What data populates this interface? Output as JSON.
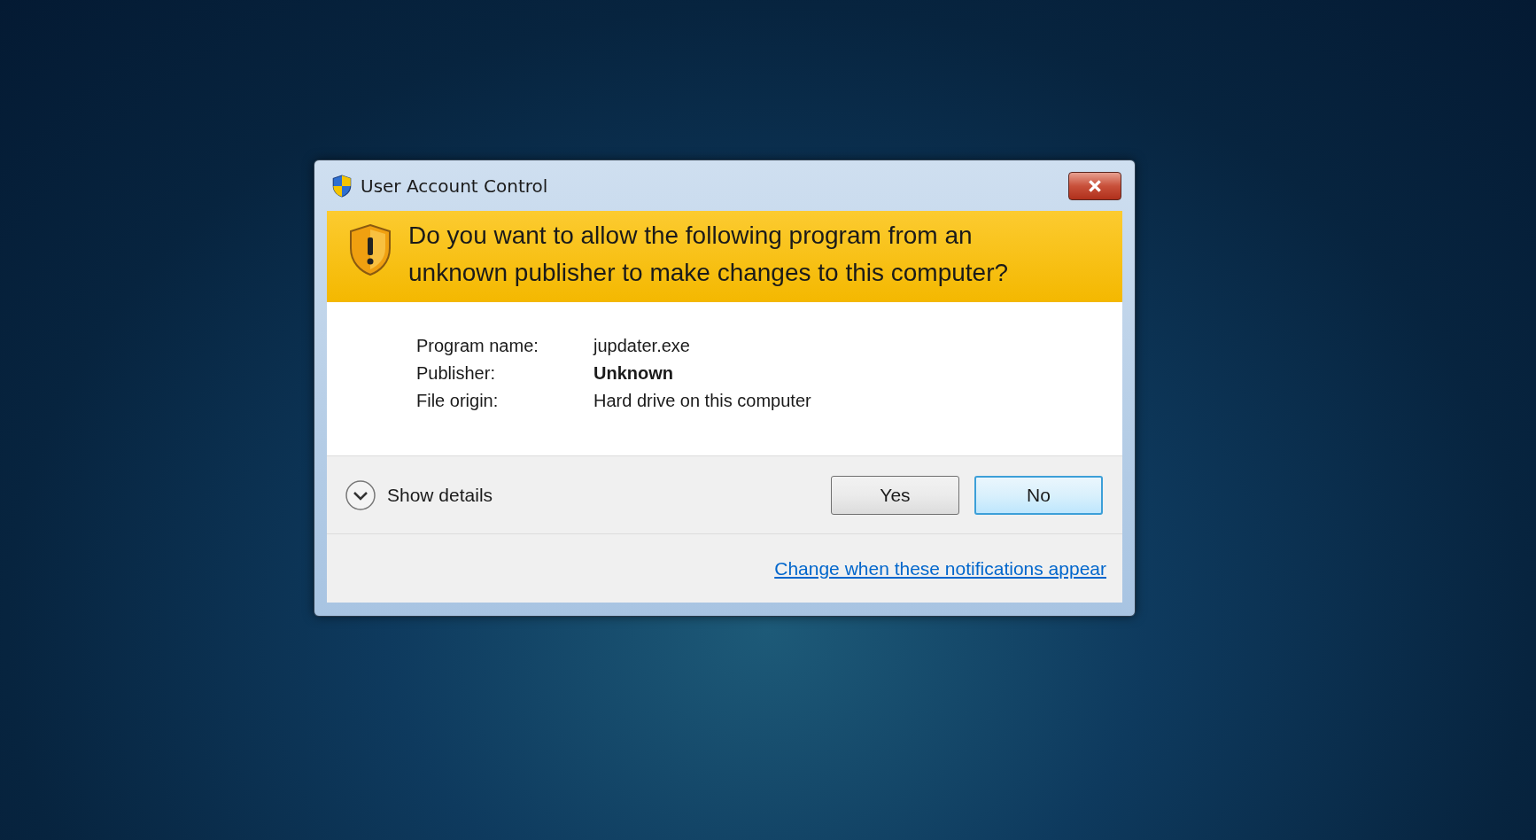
{
  "window": {
    "title": "User Account Control"
  },
  "banner": {
    "question": "Do you want to allow the following program from an unknown publisher to make changes to this computer?"
  },
  "details": [
    {
      "label": "Program name:",
      "value": "jupdater.exe",
      "emphasis": false
    },
    {
      "label": "Publisher:",
      "value": "Unknown",
      "emphasis": true
    },
    {
      "label": "File origin:",
      "value": "Hard drive on this computer",
      "emphasis": false
    }
  ],
  "show_details": {
    "label": "Show details",
    "expanded": false
  },
  "buttons": [
    {
      "label": "Yes",
      "default": false
    },
    {
      "label": "No",
      "default": true
    }
  ],
  "link": "Change when these notifications appear"
}
